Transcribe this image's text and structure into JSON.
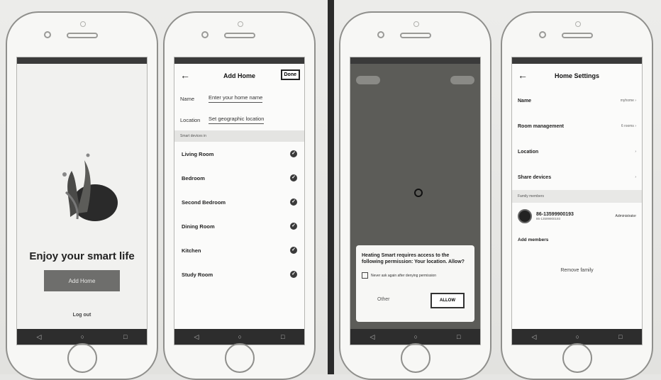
{
  "screen1": {
    "tagline": "Enjoy your smart life",
    "add_home_label": "Add Home",
    "logout_label": "Log out"
  },
  "screen2": {
    "back_icon": "arrow-left-icon",
    "title": "Add Home",
    "done_label": "Done",
    "name_label": "Name",
    "name_placeholder": "Enter your home name",
    "location_label": "Location",
    "location_value": "Set geographic location",
    "section_label": "Smart devices in",
    "rooms": [
      {
        "label": "Living Room"
      },
      {
        "label": "Bedroom"
      },
      {
        "label": "Second Bedroom"
      },
      {
        "label": "Dining Room"
      },
      {
        "label": "Kitchen"
      },
      {
        "label": "Study Room"
      }
    ]
  },
  "screen3": {
    "dialog_text": "Heating Smart requires access to the following permission: Your location. Allow?",
    "never_ask_label": "Never ask again after denying permission",
    "other_label": "Other",
    "allow_label": "ALLOW"
  },
  "screen4": {
    "back_icon": "arrow-left-icon",
    "title": "Home Settings",
    "rows": [
      {
        "label": "Name",
        "value": "myhome"
      },
      {
        "label": "Room management",
        "value": "6 rooms"
      },
      {
        "label": "Location",
        "value": ""
      },
      {
        "label": "Share devices",
        "value": ""
      }
    ],
    "family_section": "Family members",
    "member_name": "86-13599900193",
    "member_sub": "86-13599900193",
    "member_role": "Administrator",
    "add_members_label": "Add members",
    "remove_label": "Remove family"
  },
  "colors": {
    "divider": "#2b2b2b",
    "map_bg": "#5c5c58",
    "check": "#3a3a3a"
  }
}
